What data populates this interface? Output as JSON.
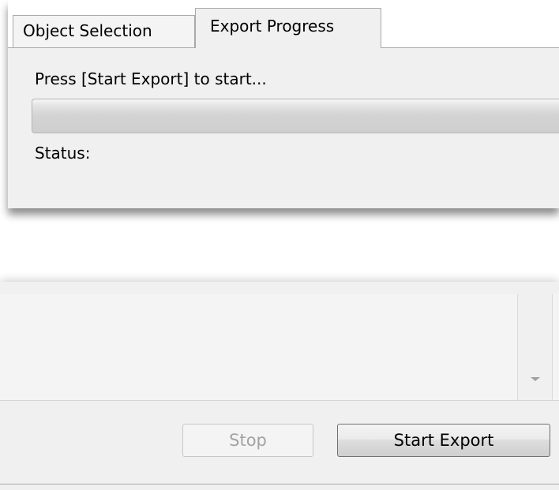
{
  "tabs": [
    {
      "label": "Object Selection",
      "active": false
    },
    {
      "label": "Export Progress",
      "active": true
    }
  ],
  "export_panel": {
    "instruction": "Press [Start Export] to start...",
    "progress_fraction": 0,
    "status_label": "Status:"
  },
  "buttons": {
    "stop_label": "Stop",
    "stop_enabled": false,
    "start_label": "Start Export",
    "start_enabled": true
  },
  "icons": {
    "scroll_down": "scroll-down-arrow-icon"
  },
  "colors": {
    "window_bg": "#f0f0f0",
    "disabled_text": "#a3a3a3",
    "border": "#a9a9a9"
  }
}
